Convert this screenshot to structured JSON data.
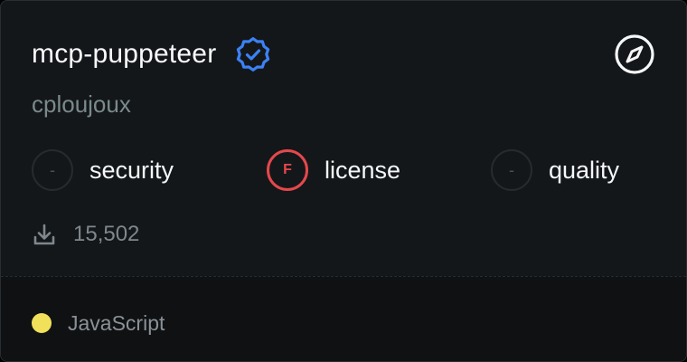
{
  "server": {
    "name": "mcp-puppeteer",
    "author": "cploujoux",
    "verified_icon": "verified-badge-icon",
    "compass_icon": "compass-icon"
  },
  "scores": [
    {
      "label": "security",
      "grade": "-",
      "status": "none"
    },
    {
      "label": "license",
      "grade": "F",
      "status": "fail"
    },
    {
      "label": "quality",
      "grade": "-",
      "status": "none"
    }
  ],
  "stats": {
    "download_icon": "download-icon",
    "downloads": "15,502"
  },
  "footer": {
    "language": "JavaScript",
    "language_color": "#f1e05a"
  },
  "colors": {
    "verified": "#3b82f6",
    "fail": "#e5484d",
    "background": "#141719"
  }
}
